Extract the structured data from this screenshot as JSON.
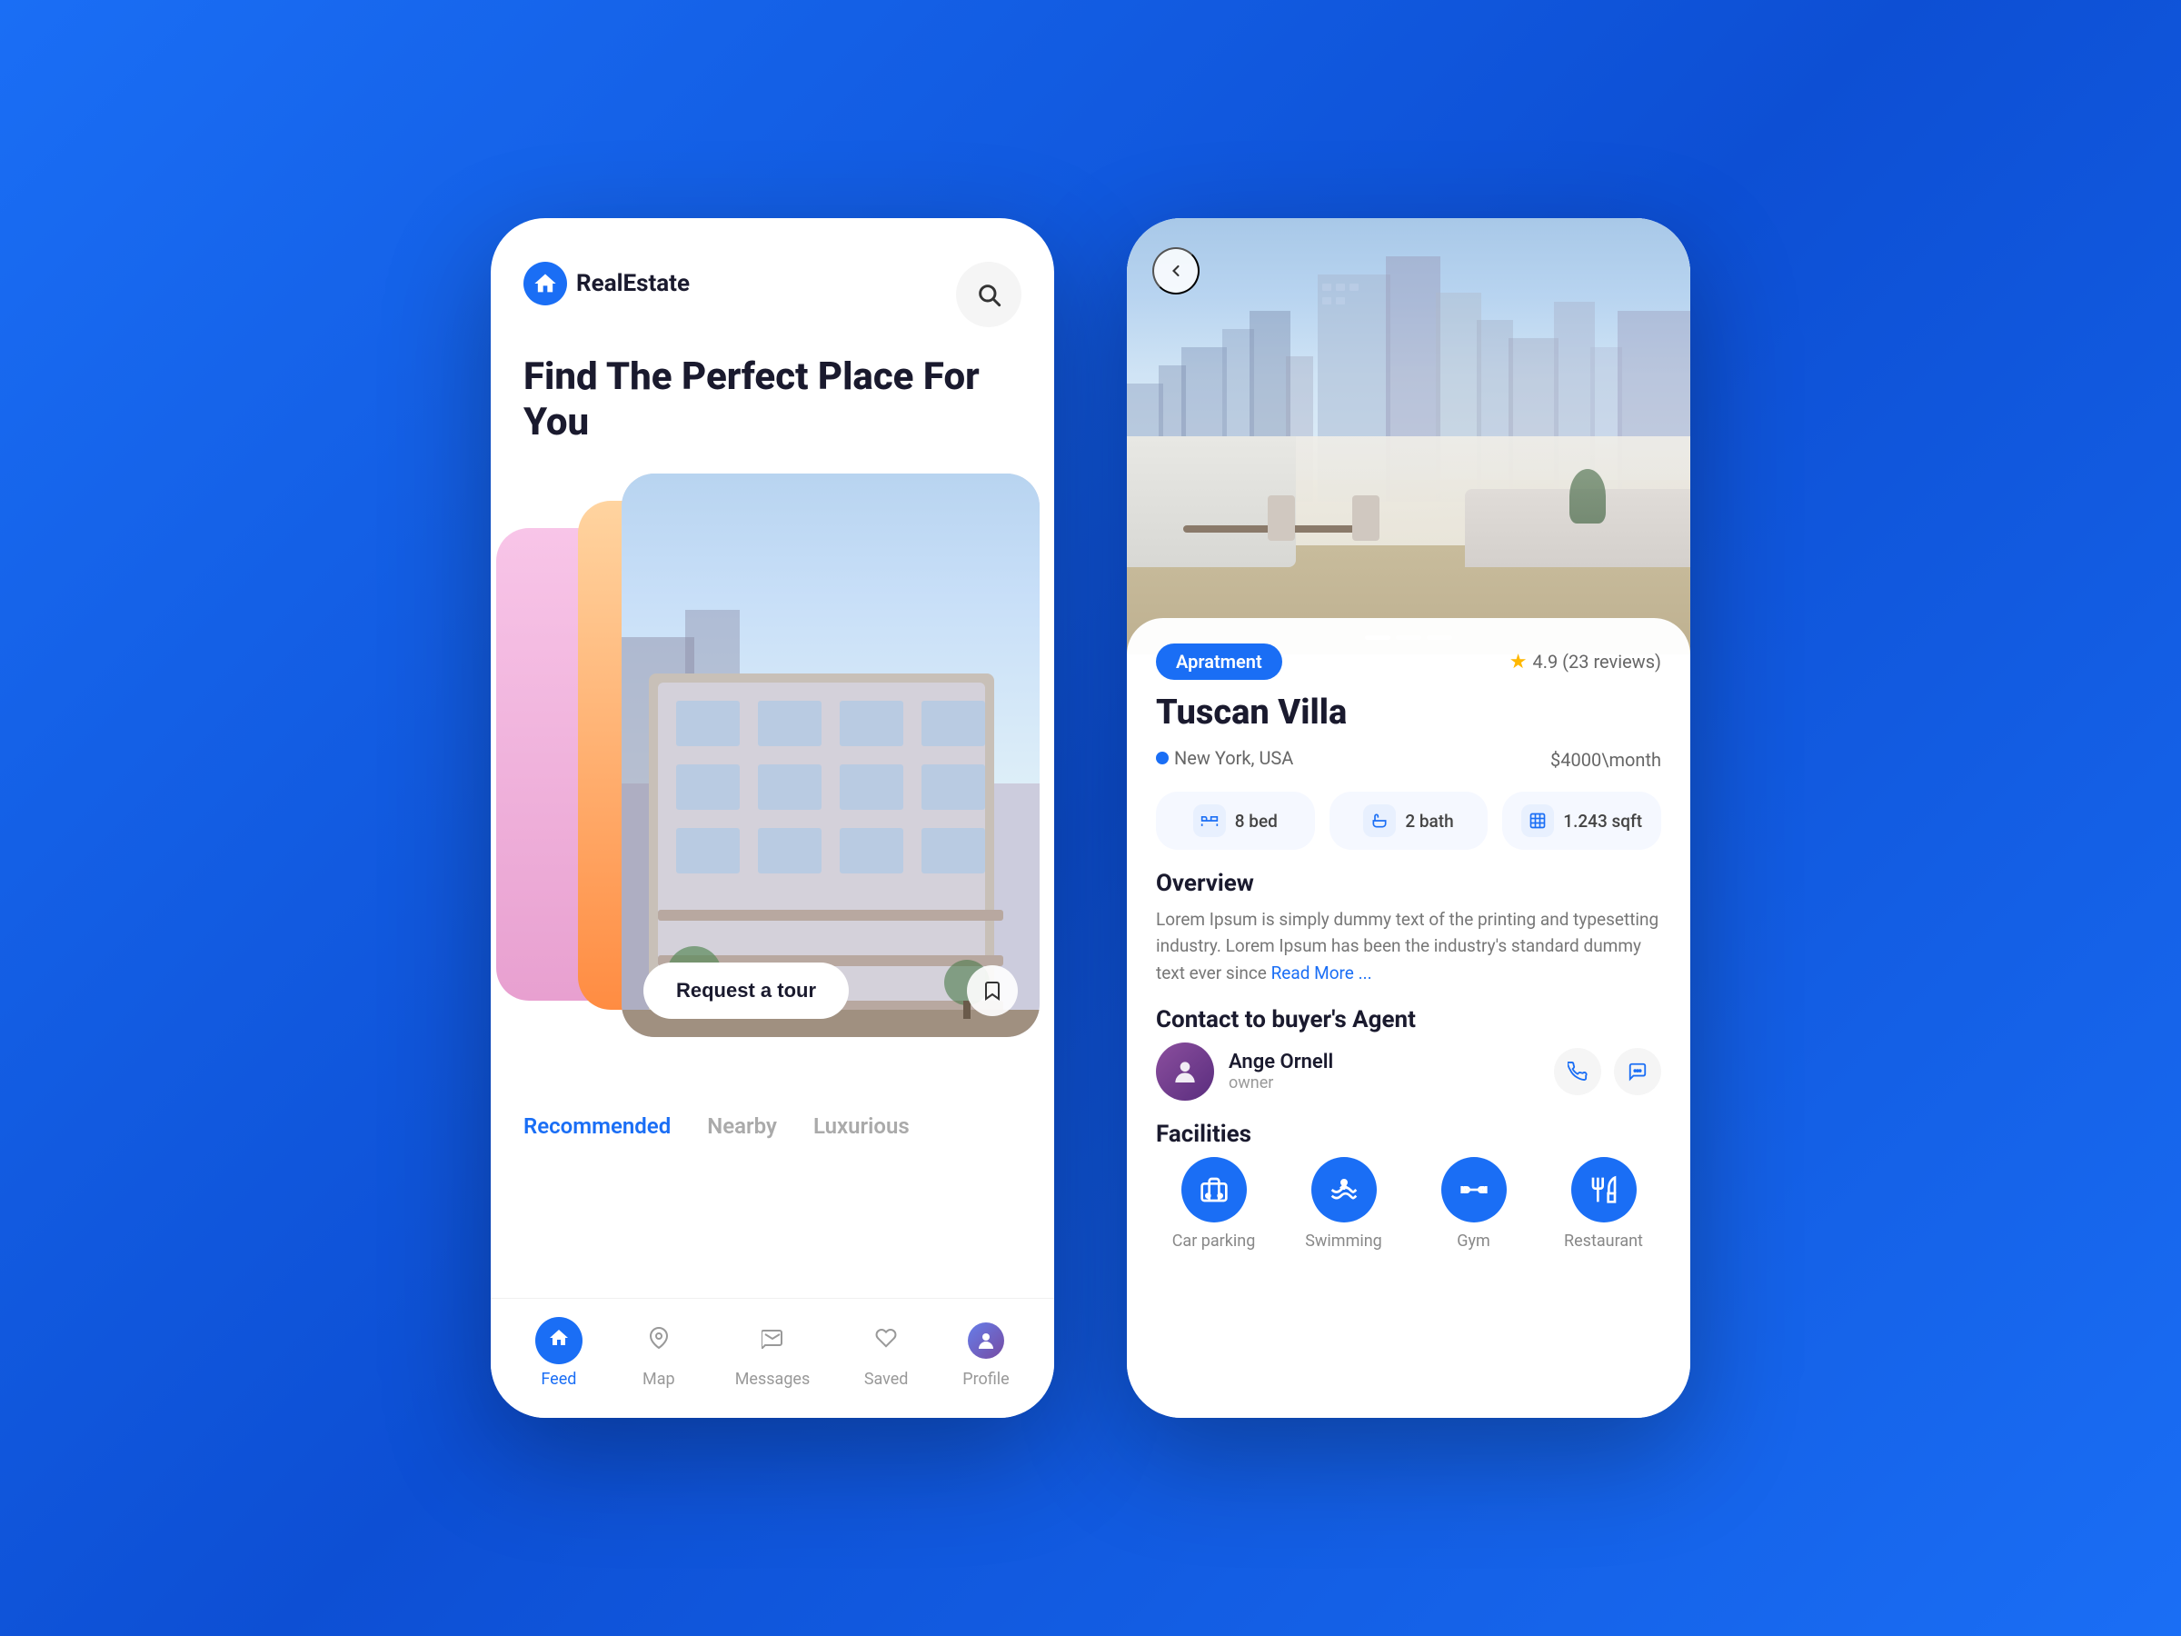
{
  "phone1": {
    "logo": {
      "text": "RealEstate",
      "icon": "🏠"
    },
    "headline": "Find The Perfect Place For You",
    "search_btn_aria": "Search",
    "cards": {
      "tour_button": "Request a tour",
      "bookmark_aria": "Bookmark"
    },
    "tabs": [
      {
        "label": "Recommended",
        "active": true
      },
      {
        "label": "Nearby",
        "active": false
      },
      {
        "label": "Luxurious",
        "active": false
      }
    ],
    "nav": [
      {
        "label": "Feed",
        "icon": "🏠",
        "active": true
      },
      {
        "label": "Map",
        "icon": "📍",
        "active": false
      },
      {
        "label": "Messages",
        "icon": "✉️",
        "active": false
      },
      {
        "label": "Saved",
        "icon": "❤️",
        "active": false
      },
      {
        "label": "Profile",
        "icon": "👤",
        "active": false
      }
    ]
  },
  "phone2": {
    "back_btn": "←",
    "property_type": "Apratment",
    "rating": "4.9 (23 reviews)",
    "property_name": "Tuscan Villa",
    "location": "New York, USA",
    "price": "$4000",
    "price_period": "\\month",
    "features": [
      {
        "icon": "🛏",
        "value": "8",
        "label": "bed"
      },
      {
        "icon": "🛁",
        "value": "2",
        "label": "bath"
      },
      {
        "icon": "📐",
        "value": "1.243",
        "label": "sqft"
      }
    ],
    "overview_title": "Overview",
    "overview_text": "Lorem Ipsum is simply dummy text of the printing and typesetting industry. Lorem Ipsum has been the industry's standard dummy text ever since",
    "read_more": "Read More ...",
    "contact_title": "Contact to buyer's Agent",
    "agent": {
      "name": "Ange Ornell",
      "role": "owner"
    },
    "facilities_title": "Facilities",
    "facilities": [
      {
        "icon": "🚗",
        "label": "Car parking"
      },
      {
        "icon": "🏊",
        "label": "Swimming"
      },
      {
        "icon": "🏋",
        "label": "Gym"
      },
      {
        "icon": "🍽",
        "label": "Restaurant"
      }
    ]
  }
}
